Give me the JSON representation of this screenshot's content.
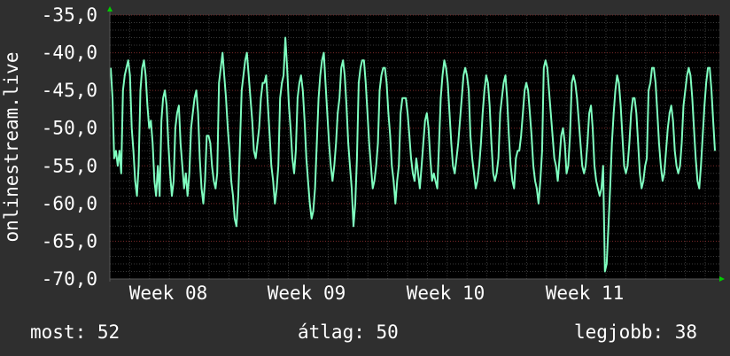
{
  "chart_data": {
    "type": "line",
    "ylabel": "onlinestream.live",
    "ylim": [
      -70,
      -35
    ],
    "y_ticks": [
      "-35,0",
      "-40,0",
      "-45,0",
      "-50,0",
      "-55,0",
      "-60,0",
      "-65,0",
      "-70,0"
    ],
    "x_ticks": [
      "Week 08",
      "Week 09",
      "Week 10",
      "Week 11"
    ],
    "grid": true,
    "colors": {
      "background": "#2f2f2f",
      "plot": "#000000",
      "line": "#7fffc0",
      "grid_major": "#7a2a2a",
      "grid_minor": "#3a3a3a",
      "axis_arrow": "#00cc00",
      "text": "#ffffff"
    },
    "series": [
      {
        "color": "#7fffc0",
        "values": [
          -42,
          -46,
          -54,
          -53,
          -55,
          -53,
          -56,
          -45,
          -43,
          -42,
          -41,
          -43,
          -50,
          -53,
          -57,
          -59,
          -55,
          -45,
          -42,
          -41,
          -43,
          -47,
          -50,
          -49,
          -52,
          -57,
          -59,
          -55,
          -59,
          -49,
          -46,
          -45,
          -47,
          -52,
          -56,
          -59,
          -57,
          -50,
          -48,
          -47,
          -52,
          -55,
          -58,
          -56,
          -59,
          -56,
          -50,
          -48,
          -46,
          -45,
          -48,
          -54,
          -58,
          -60,
          -57,
          -51,
          -51,
          -52,
          -55,
          -57,
          -58,
          -56,
          -44,
          -42,
          -40,
          -43,
          -46,
          -50,
          -53,
          -57,
          -59,
          -62,
          -63,
          -59,
          -52,
          -45,
          -43,
          -41,
          -40,
          -43,
          -46,
          -49,
          -53,
          -54,
          -52,
          -50,
          -46,
          -44,
          -44,
          -43,
          -47,
          -51,
          -55,
          -57,
          -60,
          -58,
          -55,
          -46,
          -44,
          -43,
          -38,
          -42,
          -47,
          -50,
          -54,
          -56,
          -53,
          -46,
          -44,
          -43,
          -45,
          -49,
          -54,
          -57,
          -60,
          -62,
          -61,
          -58,
          -52,
          -46,
          -43,
          -41,
          -40,
          -44,
          -48,
          -52,
          -55,
          -57,
          -55,
          -52,
          -48,
          -46,
          -42,
          -41,
          -43,
          -47,
          -52,
          -55,
          -58,
          -63,
          -60,
          -54,
          -44,
          -42,
          -41,
          -41,
          -44,
          -48,
          -52,
          -55,
          -58,
          -57,
          -55,
          -52,
          -45,
          -43,
          -42,
          -42,
          -44,
          -48,
          -51,
          -55,
          -57,
          -60,
          -57,
          -55,
          -48,
          -46,
          -46,
          -46,
          -48,
          -51,
          -54,
          -56,
          -57,
          -54,
          -56,
          -58,
          -55,
          -52,
          -49,
          -48,
          -50,
          -54,
          -57,
          -56,
          -57,
          -58,
          -52,
          -46,
          -43,
          -41,
          -42,
          -44,
          -48,
          -52,
          -55,
          -56,
          -54,
          -52,
          -49,
          -46,
          -43,
          -42,
          -43,
          -45,
          -51,
          -54,
          -56,
          -58,
          -57,
          -55,
          -52,
          -48,
          -45,
          -43,
          -44,
          -47,
          -52,
          -56,
          -57,
          -56,
          -54,
          -48,
          -46,
          -44,
          -43,
          -46,
          -51,
          -55,
          -57,
          -58,
          -54,
          -53,
          -53,
          -51,
          -48,
          -45,
          -44,
          -45,
          -48,
          -51,
          -55,
          -57,
          -58,
          -60,
          -57,
          -53,
          -42,
          -41,
          -42,
          -45,
          -48,
          -51,
          -54,
          -55,
          -57,
          -54,
          -51,
          -50,
          -52,
          -56,
          -55,
          -51,
          -44,
          -43,
          -44,
          -46,
          -49,
          -52,
          -55,
          -56,
          -55,
          -52,
          -48,
          -47,
          -50,
          -55,
          -57,
          -58,
          -59,
          -58,
          -55,
          -69,
          -68,
          -63,
          -58,
          -52,
          -48,
          -45,
          -43,
          -44,
          -47,
          -51,
          -55,
          -56,
          -55,
          -52,
          -48,
          -46,
          -46,
          -48,
          -52,
          -56,
          -58,
          -57,
          -55,
          -54,
          -45,
          -44,
          -42,
          -42,
          -44,
          -48,
          -52,
          -55,
          -57,
          -56,
          -53,
          -50,
          -48,
          -47,
          -49,
          -53,
          -55,
          -56,
          -55,
          -52,
          -47,
          -45,
          -43,
          -42,
          -43,
          -46,
          -50,
          -54,
          -57,
          -58,
          -55,
          -51,
          -47,
          -44,
          -42,
          -42,
          -45,
          -49,
          -53
        ]
      }
    ],
    "stats": [
      {
        "label": "most: 52"
      },
      {
        "label": "átlag: 50"
      },
      {
        "label": "legjobb: 38"
      }
    ]
  }
}
